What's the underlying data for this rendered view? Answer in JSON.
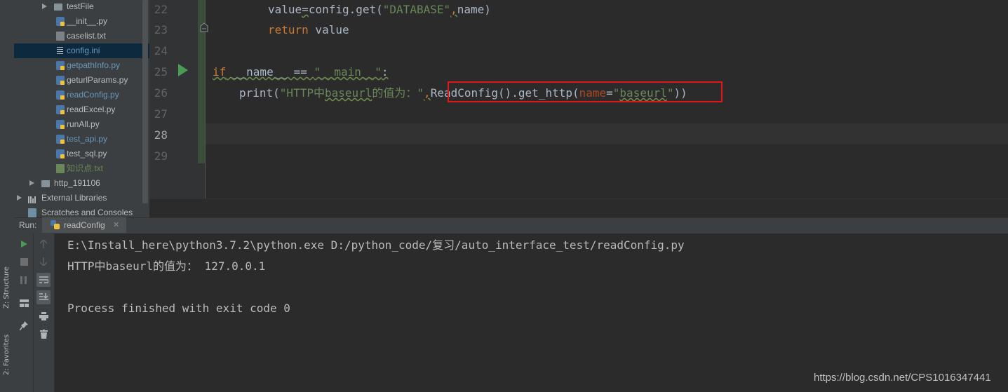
{
  "colors": {
    "background": "#2b2b2b",
    "panel": "#3c3f41",
    "keyword": "#cc7832",
    "string": "#6a8759",
    "param": "#aa4926",
    "highlight_box": "#e0161b",
    "run_green": "#499c54"
  },
  "tool_windows": {
    "structure": "Z: Structure",
    "favorites": "2: Favorites"
  },
  "project_tree": [
    {
      "label": "testFile",
      "icon": "folder-icon",
      "expandable": true
    },
    {
      "label": "__init__.py",
      "icon": "python-file-icon"
    },
    {
      "label": "caselist.txt",
      "icon": "text-file-icon"
    },
    {
      "label": "config.ini",
      "icon": "ini-file-icon",
      "selected": true
    },
    {
      "label": "getpathInfo.py",
      "icon": "python-file-icon"
    },
    {
      "label": "geturlParams.py",
      "icon": "python-file-icon"
    },
    {
      "label": "readConfig.py",
      "icon": "python-file-icon"
    },
    {
      "label": "readExcel.py",
      "icon": "python-file-icon"
    },
    {
      "label": "runAll.py",
      "icon": "python-file-icon"
    },
    {
      "label": "test_api.py",
      "icon": "python-file-icon"
    },
    {
      "label": "test_sql.py",
      "icon": "python-file-icon"
    },
    {
      "label": "知识点.txt",
      "icon": "text-file-icon"
    },
    {
      "label": "http_191106",
      "icon": "folder-icon",
      "expandable": true
    },
    {
      "label": "External Libraries",
      "icon": "libraries-icon",
      "expandable": true
    },
    {
      "label": "Scratches and Consoles",
      "icon": "scratches-icon"
    }
  ],
  "editor": {
    "line_numbers": [
      "22",
      "23",
      "24",
      "25",
      "26",
      "27",
      "28",
      "29"
    ],
    "line22": {
      "a": "value",
      "b": "=",
      "c": "config.get(",
      "d": "\"DATABASE\"",
      "e": ",",
      "f": "name)"
    },
    "line23": {
      "kw": "return",
      "rest": " value"
    },
    "line25": {
      "kw": "if",
      "a": " __name__ == ",
      "b": "\"__main__\"",
      "c": ":"
    },
    "line26": {
      "a": "print(",
      "b": "\"HTTP中",
      "c": "baseurl",
      "d": "的值为：\"",
      "e": ",",
      "f": "ReadConfig().get_http(",
      "g": "name",
      "h": "=",
      "i": "\"",
      "j": "baseurl",
      "k": "\"",
      "l": "))"
    }
  },
  "run_panel": {
    "label": "Run:",
    "tab": "readConfig",
    "console": [
      "E:\\Install_here\\python3.7.2\\python.exe D:/python_code/复习/auto_interface_test/readConfig.py",
      "HTTP中baseurl的值为： 127.0.0.1",
      "",
      "Process finished with exit code 0"
    ]
  },
  "watermark": "https://blog.csdn.net/CPS1016347441"
}
